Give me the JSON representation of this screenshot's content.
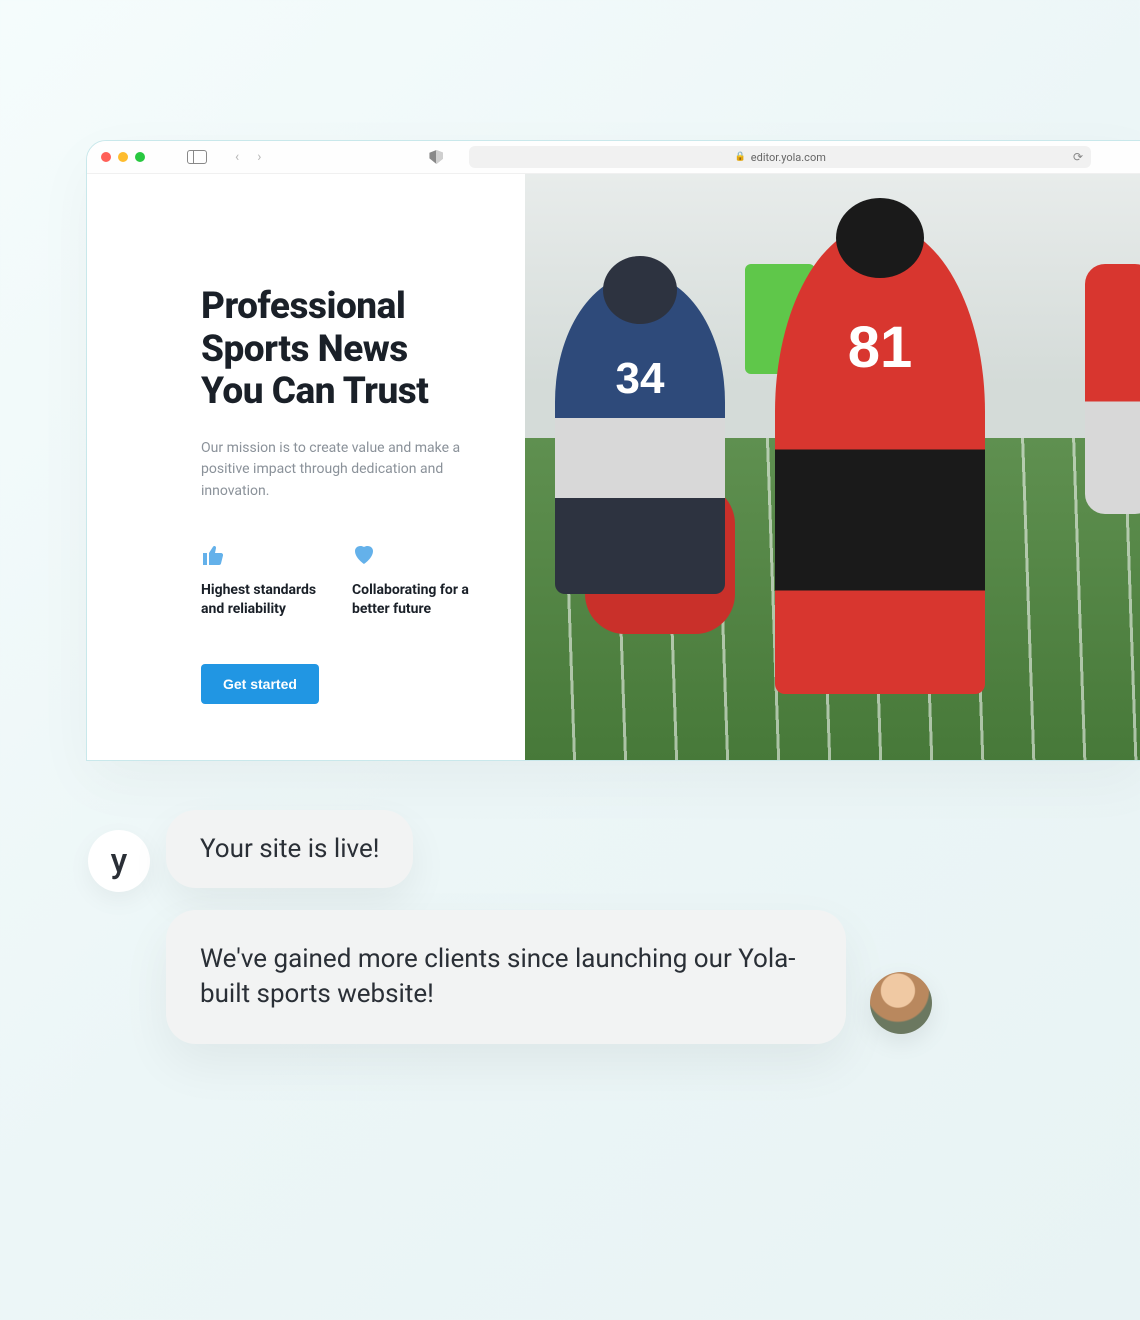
{
  "browser": {
    "url": "editor.yola.com"
  },
  "page": {
    "heading": "Professional Sports News You Can Trust",
    "mission": "Our mission is to create value and make a positive impact through dedication and innovation.",
    "features": [
      {
        "icon": "thumbs-up-icon",
        "text": "Highest standards and reliability"
      },
      {
        "icon": "heart-icon",
        "text": "Collaborating for a better future"
      }
    ],
    "cta_label": "Get started",
    "hero_image": {
      "subject": "American football players",
      "visible_jerseys": [
        "34",
        "81"
      ]
    }
  },
  "chat": {
    "assistant_avatar_letter": "y",
    "message_1": "Your site is live!",
    "message_2": "We've gained more clients since launching our Yola-built sports website!"
  },
  "colors": {
    "accent_blue": "#2196e3",
    "icon_blue": "#64b1ea",
    "text_dark": "#1a2028",
    "text_muted": "#8a9199"
  }
}
